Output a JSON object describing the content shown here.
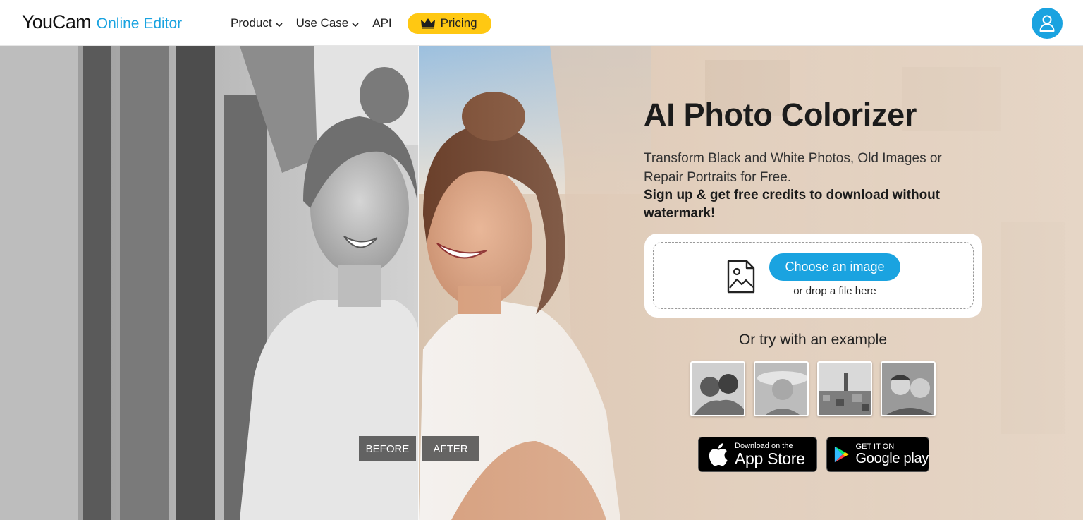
{
  "header": {
    "logo_main": "YouCam",
    "logo_sub": "Online Editor",
    "nav": [
      {
        "label": "Product"
      },
      {
        "label": "Use Case"
      },
      {
        "label": "API"
      }
    ],
    "pricing_label": "Pricing",
    "icons": {
      "crown": "crown-icon",
      "user": "user-icon",
      "chevron": "chevron-down-icon"
    }
  },
  "hero": {
    "before_label": "BEFORE",
    "after_label": "AFTER",
    "title": "AI Photo Colorizer",
    "description": "Transform Black and White Photos, Old Images or Repair Portraits for Free.",
    "description_strong": "Sign up & get free credits to download without watermark!",
    "upload": {
      "button_label": "Choose an image",
      "drop_text": "or drop a file here",
      "icon": "image-file-icon"
    },
    "try_text": "Or try with an example",
    "stores": {
      "apple_small": "Download on the",
      "apple_big": "App Store",
      "google_small": "GET IT ON",
      "google_big": "Google play"
    }
  },
  "colors": {
    "brand_blue": "#1aa3e0",
    "pricing_yellow": "#ffc812"
  }
}
